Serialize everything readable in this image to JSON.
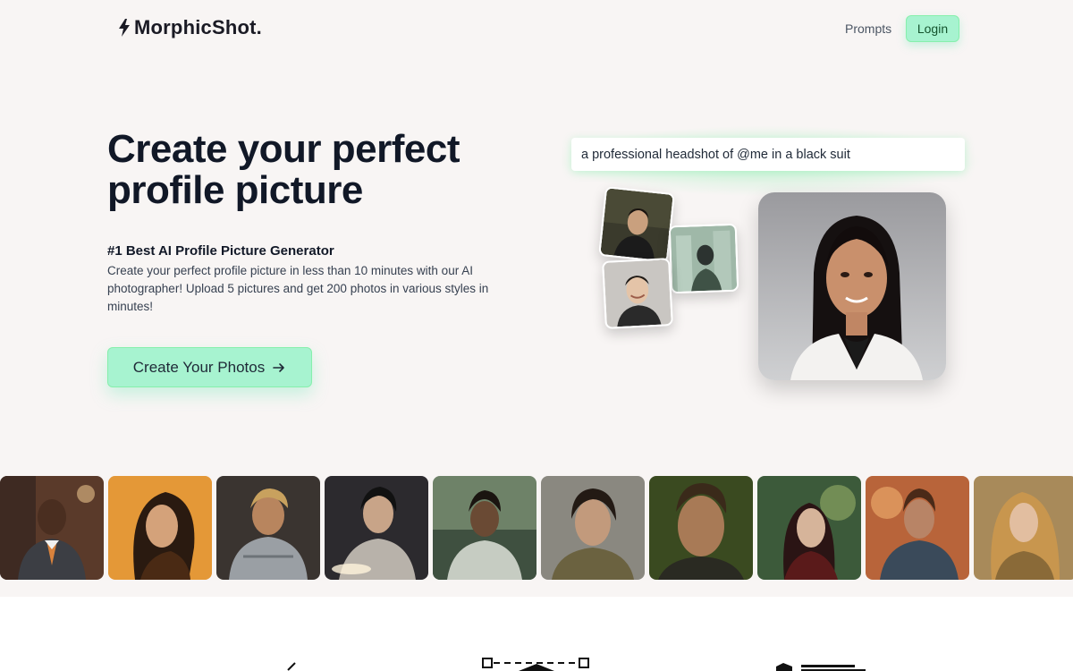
{
  "header": {
    "logo_text": "MorphicShot.",
    "logo_icon": "bolt-icon",
    "nav_prompts": "Prompts",
    "login_label": "Login"
  },
  "hero": {
    "title": "Create your perfect profile picture",
    "subtitle": "#1 Best AI Profile Picture Generator",
    "description": "Create your perfect profile picture in less than 10 minutes with our AI photographer! Upload 5 pictures and get 200 photos in various styles in minutes!",
    "cta_label": "Create Your Photos",
    "cta_icon": "arrow-right-icon"
  },
  "showcase": {
    "prompt_text": "a professional headshot of @me in a black suit"
  },
  "colors": {
    "background": "#f8f5f4",
    "accent": "#a7f3d0",
    "accent_border": "#86efac",
    "text": "#111827"
  },
  "gallery": {
    "count": 10
  }
}
